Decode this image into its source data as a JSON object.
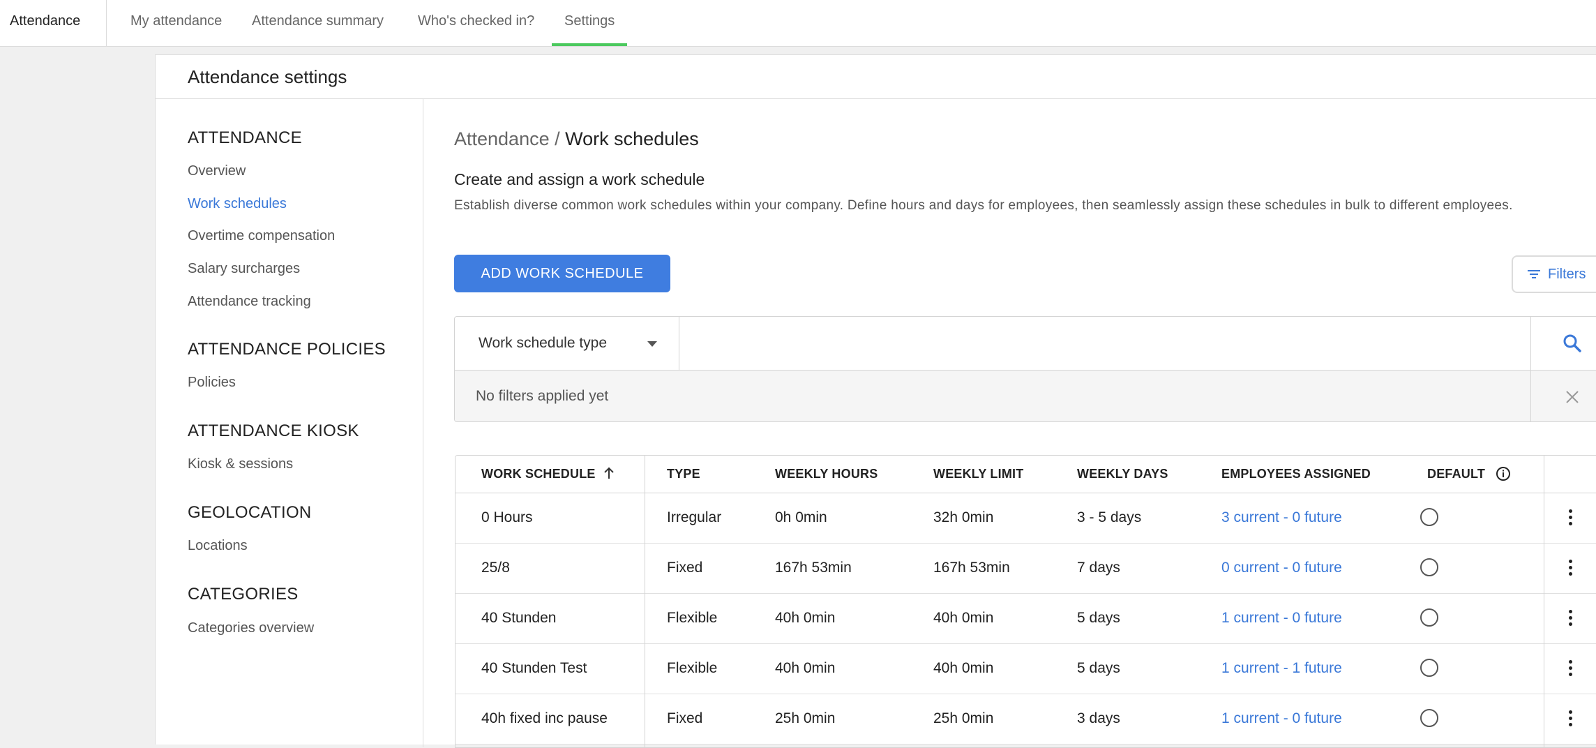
{
  "nav": {
    "app_title": "Attendance",
    "tabs": [
      {
        "label": "My attendance"
      },
      {
        "label": "Attendance summary"
      },
      {
        "label": "Who's checked in?"
      },
      {
        "label": "Settings",
        "active": true
      }
    ]
  },
  "panel": {
    "title": "Attendance settings"
  },
  "sidebar": {
    "sections": [
      {
        "heading": "ATTENDANCE",
        "items": [
          "Overview",
          "Work schedules",
          "Overtime compensation",
          "Salary surcharges",
          "Attendance tracking"
        ]
      },
      {
        "heading": "ATTENDANCE POLICIES",
        "items": [
          "Policies"
        ]
      },
      {
        "heading": "ATTENDANCE KIOSK",
        "items": [
          "Kiosk & sessions"
        ]
      },
      {
        "heading": "GEOLOCATION",
        "items": [
          "Locations"
        ]
      },
      {
        "heading": "CATEGORIES",
        "items": [
          "Categories overview"
        ]
      }
    ],
    "active_item": "Work schedules"
  },
  "content": {
    "breadcrumb": {
      "parent": "Attendance",
      "separator": "/",
      "current": "Work schedules"
    },
    "heading": "Create and assign a work schedule",
    "description": "Establish diverse common work schedules within your company. Define hours and days for employees, then seamlessly assign these schedules in bulk to different employees.",
    "add_button": "ADD WORK SCHEDULE",
    "filters_button": "Filters",
    "search": {
      "type_select": "Work schedule type",
      "placeholder": "",
      "no_filters": "No filters applied yet"
    }
  },
  "table": {
    "headers": [
      "WORK SCHEDULE",
      "TYPE",
      "WEEKLY HOURS",
      "WEEKLY LIMIT",
      "WEEKLY DAYS",
      "EMPLOYEES ASSIGNED",
      "DEFAULT"
    ],
    "rows": [
      {
        "name": "0 Hours",
        "type": "Irregular",
        "weekly_hours": "0h 0min",
        "weekly_limit": "32h 0min",
        "weekly_days": "3 - 5 days",
        "employees": "3 current - 0 future"
      },
      {
        "name": "25/8",
        "type": "Fixed",
        "weekly_hours": "167h 53min",
        "weekly_limit": "167h 53min",
        "weekly_days": "7 days",
        "employees": "0 current - 0 future"
      },
      {
        "name": "40 Stunden",
        "type": "Flexible",
        "weekly_hours": "40h 0min",
        "weekly_limit": "40h 0min",
        "weekly_days": "5 days",
        "employees": "1 current - 0 future"
      },
      {
        "name": "40 Stunden Test",
        "type": "Flexible",
        "weekly_hours": "40h 0min",
        "weekly_limit": "40h 0min",
        "weekly_days": "5 days",
        "employees": "1 current - 1 future"
      },
      {
        "name": "40h fixed inc pause",
        "type": "Fixed",
        "weekly_hours": "25h 0min",
        "weekly_limit": "25h 0min",
        "weekly_days": "3 days",
        "employees": "1 current - 0 future"
      }
    ]
  },
  "colors": {
    "accent": "#3f7de0",
    "link": "#3a78d8",
    "active_tab_underline": "#4cc95e"
  }
}
